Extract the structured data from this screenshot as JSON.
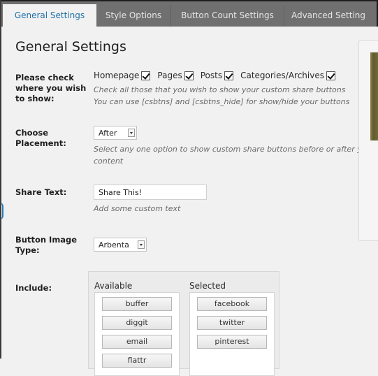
{
  "tabs": [
    {
      "label": "General Settings"
    },
    {
      "label": "Style Options"
    },
    {
      "label": "Button Count Settings"
    },
    {
      "label": "Advanced Setting"
    }
  ],
  "page_title": "General Settings",
  "show_on": {
    "label_lines": [
      "Please check",
      "where you wish",
      "to show:"
    ],
    "options": [
      {
        "label": "Homepage",
        "checked": true
      },
      {
        "label": "Pages",
        "checked": true
      },
      {
        "label": "Posts",
        "checked": true
      },
      {
        "label": "Categories/Archives",
        "checked": true
      }
    ],
    "help_lines": [
      "Check all those that you wish to show your custom share buttons",
      "You can use [csbtns] and [csbtns_hide] for show/hide your buttons"
    ]
  },
  "placement": {
    "label_lines": [
      "Choose",
      "Placement:"
    ],
    "selected": "After",
    "help_lines": [
      "Select any one option to show custom share buttons before or after your",
      "content"
    ]
  },
  "share_text": {
    "label": "Share Text:",
    "value": "Share This!",
    "help": "Add some custom text"
  },
  "button_image": {
    "label_lines": [
      "Button Image",
      "Type:"
    ],
    "selected": "Arbenta"
  },
  "include": {
    "label": "Include:",
    "available_title": "Available",
    "selected_title": "Selected",
    "available": [
      "buffer",
      "diggit",
      "email",
      "flattr"
    ],
    "selected": [
      "facebook",
      "twitter",
      "pinterest"
    ]
  }
}
